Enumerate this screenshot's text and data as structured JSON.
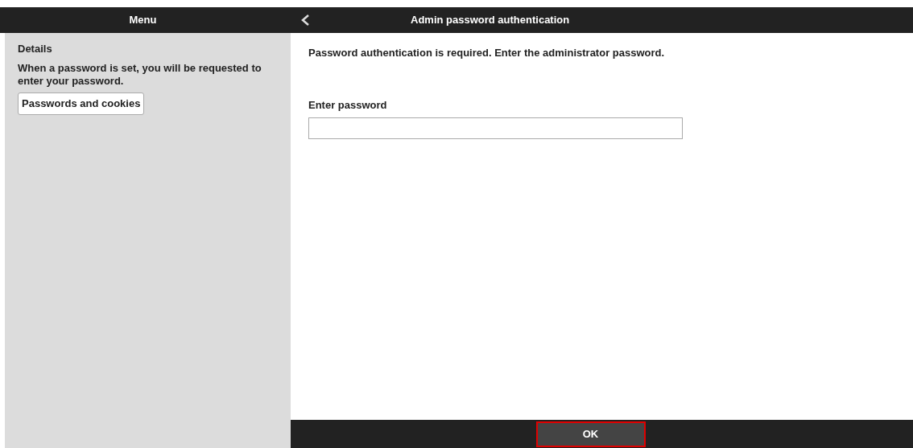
{
  "menu": {
    "title": "Menu",
    "details_heading": "Details",
    "details_text": "When a password is set, you will be requested to enter your password.",
    "link_button": "Passwords and cookies"
  },
  "page": {
    "title": "Admin password authentication",
    "message": "Password authentication is required. Enter the administrator password.",
    "field_label": "Enter password"
  },
  "footer": {
    "ok_button": {
      "label": "OK",
      "focused": true
    }
  }
}
